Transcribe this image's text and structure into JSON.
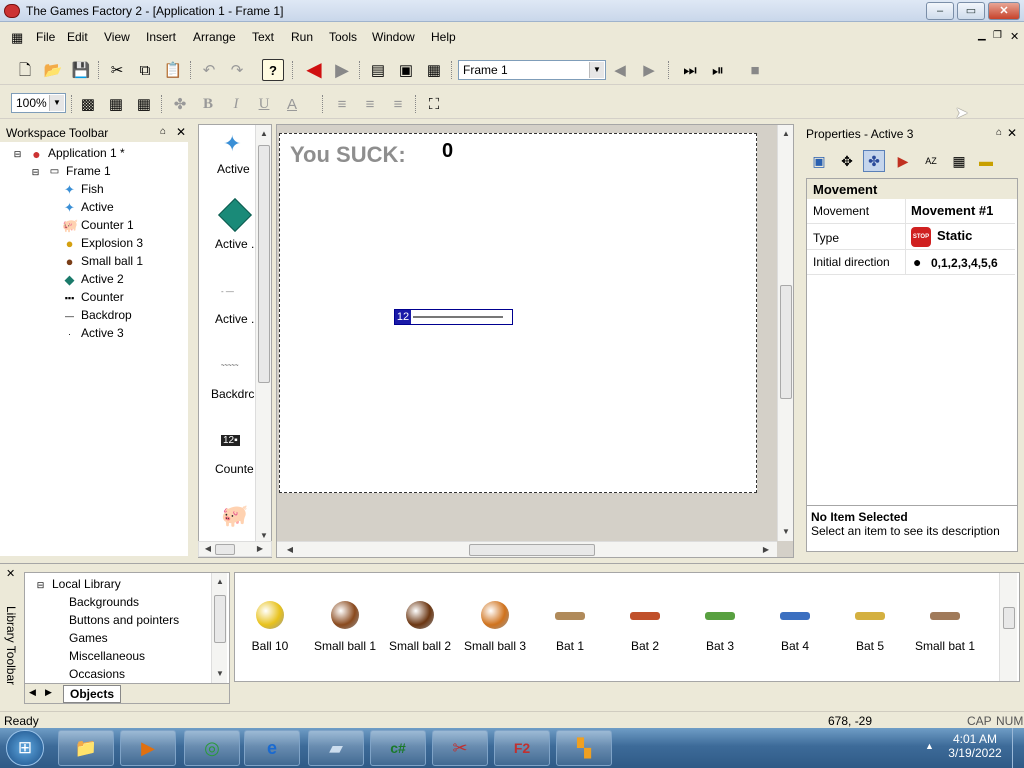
{
  "window": {
    "title": "The Games Factory 2 - [Application 1 - Frame 1]",
    "controls": [
      "–",
      "▭",
      "✕"
    ]
  },
  "menu": [
    "File",
    "Edit",
    "View",
    "Insert",
    "Arrange",
    "Text",
    "Run",
    "Tools",
    "Window",
    "Help"
  ],
  "toolbar": {
    "frame_select": "Frame 1",
    "zoom_select": "100%"
  },
  "workspace": {
    "title": "Workspace Toolbar",
    "app": "Application 1 *",
    "frame": "Frame 1",
    "items": [
      "Fish",
      "Active",
      "Counter 1",
      "Explosion 3",
      "Small ball 1",
      "Active 2",
      "Counter",
      "Backdrop",
      "Active 3"
    ]
  },
  "objectlist": {
    "items": [
      "Active",
      "Active .",
      "Active .",
      "Backdrc",
      "Counte"
    ]
  },
  "frame": {
    "score_label": "You SUCK:",
    "score_value": "0",
    "counter_value": "12"
  },
  "properties": {
    "title": "Properties - Active 3",
    "section": "Movement",
    "rows": [
      {
        "key": "Movement",
        "value": "Movement #1"
      },
      {
        "key": "Type",
        "value": "Static"
      },
      {
        "key": "Initial direction",
        "value": "0,1,2,3,4,5,6"
      }
    ],
    "desc_title": "No Item Selected",
    "desc_text": "Select an item to see its description"
  },
  "library": {
    "toolbar_label": "Library Toolbar",
    "root": "Local Library",
    "categories": [
      "Backgrounds",
      "Buttons and pointers",
      "Games",
      "Miscellaneous",
      "Occasions"
    ],
    "tab": "Objects",
    "items": [
      {
        "name": "Ball 10",
        "color": "#e8c21c"
      },
      {
        "name": "Small ball 1",
        "color": "#8a4a1e"
      },
      {
        "name": "Small ball 2",
        "color": "#6b3612"
      },
      {
        "name": "Small ball 3",
        "color": "#d0731e"
      },
      {
        "name": "Bat 1",
        "color": "#b08a5a"
      },
      {
        "name": "Bat 2",
        "color": "#c0502a"
      },
      {
        "name": "Bat 3",
        "color": "#58a040"
      },
      {
        "name": "Bat 4",
        "color": "#3b6fc0"
      },
      {
        "name": "Bat 5",
        "color": "#d4b040"
      },
      {
        "name": "Small bat 1",
        "color": "#a07a5a"
      }
    ]
  },
  "status": {
    "left": "Ready",
    "coords": "678, -29",
    "cap": "CAP",
    "num": "NUM"
  },
  "taskbar": {
    "time": "4:01 AM",
    "date": "3/19/2022"
  }
}
